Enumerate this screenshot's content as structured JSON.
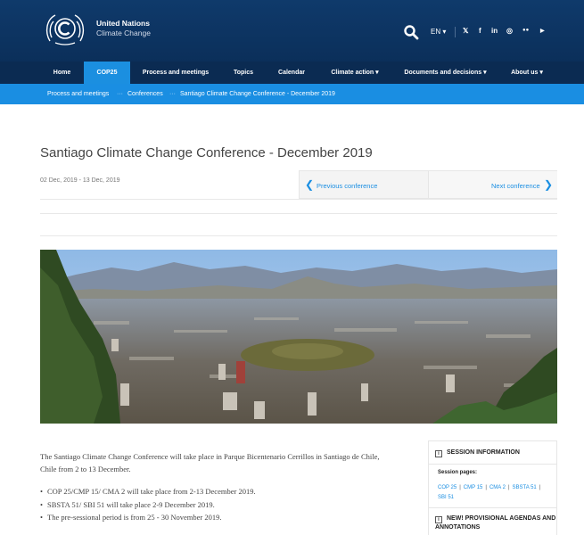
{
  "header": {
    "org_name": "United Nations",
    "org_sub": "Climate Change",
    "language": "EN ▾",
    "social": [
      "𝕏",
      "f",
      "in",
      "◎",
      "●●",
      "▶"
    ]
  },
  "nav": {
    "items": [
      "Home",
      "COP25",
      "Process and meetings",
      "Topics",
      "Calendar",
      "Climate action ▾",
      "Documents and decisions ▾",
      "About us ▾"
    ],
    "active": "COP25"
  },
  "breadcrumb": [
    "Process and meetings",
    "Conferences",
    "Santiago Climate Change Conference - December 2019"
  ],
  "page": {
    "title": "Santiago Climate Change Conference - December 2019",
    "dates": "02 Dec, 2019 - 13 Dec, 2019",
    "prev_label": "Previous conference",
    "next_label": "Next conference"
  },
  "content": {
    "intro": "The Santiago Climate Change Conference will take place in Parque Bicentenario Cerrillos in Santiago de Chile, Chile from 2 to 13 December.",
    "bullets": [
      "COP 25/CMP 15/ CMA 2 will take place from 2-13 December 2019.",
      "SBSTA 51/ SBI 51 will take place 2-9 December 2019.",
      "The pre-sessional period is from 25 - 30 November 2019."
    ]
  },
  "sidebar": {
    "heading": "SESSION INFORMATION",
    "subheading": "Session pages:",
    "links": [
      "COP 25",
      "CMP 15",
      "CMA 2",
      "SBSTA 51",
      "SBI 51"
    ],
    "heading2": "NEW! PROVISIONAL AGENDAS AND ANNOTATIONS"
  },
  "colors": {
    "header": "#0f3a6b",
    "nav": "#0b2b52",
    "accent": "#1a8ee2"
  }
}
